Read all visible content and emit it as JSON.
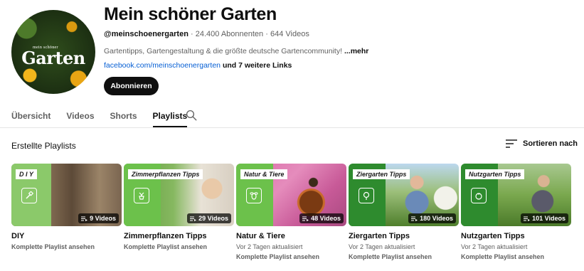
{
  "channel": {
    "title": "Mein schöner Garten",
    "handle": "@meinschoenergarten",
    "subscribers": "24.400 Abonnenten",
    "videos": "644 Videos",
    "separator": "·",
    "description": "Gartentipps, Gartengestaltung & die größte deutsche Gartencommunity!",
    "more_label": "...mehr",
    "link_text": "facebook.com/meinschoenergarten",
    "more_links": "und 7 weitere Links",
    "subscribe_label": "Abonnieren",
    "avatar_logo": "Garten",
    "avatar_logo_small": "mein schöner"
  },
  "tabs": [
    {
      "label": "Übersicht",
      "active": false
    },
    {
      "label": "Videos",
      "active": false
    },
    {
      "label": "Shorts",
      "active": false
    },
    {
      "label": "Playlists",
      "active": true
    }
  ],
  "section": {
    "title": "Erstellte Playlists",
    "sort_label": "Sortieren nach"
  },
  "playlists": [
    {
      "title": "DIY",
      "tag": "D I Y",
      "count": "9 Videos",
      "updated": "",
      "link": "Komplette Playlist ansehen",
      "icon": "hammer-icon"
    },
    {
      "title": "Zimmerpflanzen Tipps",
      "tag": "Zimmerpflanzen Tipps",
      "count": "29 Videos",
      "updated": "",
      "link": "Komplette Playlist ansehen",
      "icon": "potted-plant-icon"
    },
    {
      "title": "Natur & Tiere",
      "tag": "Natur & Tiere",
      "count": "48 Videos",
      "updated": "Vor 2 Tagen aktualisiert",
      "link": "Komplette Playlist ansehen",
      "icon": "bee-icon"
    },
    {
      "title": "Ziergarten Tipps",
      "tag": "Ziergarten Tipps",
      "count": "180 Videos",
      "updated": "Vor 2 Tagen aktualisiert",
      "link": "Komplette Playlist ansehen",
      "icon": "rose-icon"
    },
    {
      "title": "Nutzgarten Tipps",
      "tag": "Nutzgarten Tipps",
      "count": "101 Videos",
      "updated": "Vor 2 Tagen aktualisiert",
      "link": "Komplette Playlist ansehen",
      "icon": "tomato-icon"
    }
  ],
  "colors": {
    "accent_green": "#6cc14b",
    "dark_green": "#2e8b2e",
    "link_blue": "#065fd4",
    "text_primary": "#0f0f0f",
    "text_secondary": "#606060"
  }
}
